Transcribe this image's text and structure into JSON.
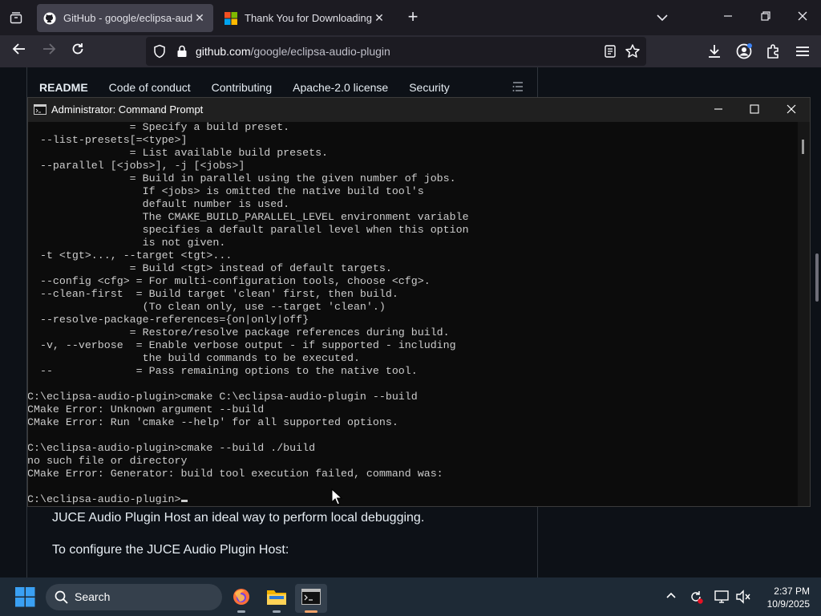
{
  "browser": {
    "tabs": [
      {
        "title": "GitHub - google/eclipsa-audio-plugin",
        "active": true
      },
      {
        "title": "Thank You for Downloading Visual Studio",
        "active": false
      }
    ],
    "url_domain": "github.com",
    "url_path": "/google/eclipsa-audio-plugin"
  },
  "page": {
    "readme_tabs": [
      "README",
      "Code of conduct",
      "Contributing",
      "Apache-2.0 license",
      "Security"
    ],
    "text_line1": "JUCE Audio Plugin Host an ideal way to perform local debugging.",
    "text_line2": "To configure the JUCE Audio Plugin Host:"
  },
  "cmd": {
    "title": "Administrator: Command Prompt",
    "lines": [
      "                = Specify a build preset.",
      "  --list-presets[=<type>]",
      "                = List available build presets.",
      "  --parallel [<jobs>], -j [<jobs>]",
      "                = Build in parallel using the given number of jobs.",
      "                  If <jobs> is omitted the native build tool's",
      "                  default number is used.",
      "                  The CMAKE_BUILD_PARALLEL_LEVEL environment variable",
      "                  specifies a default parallel level when this option",
      "                  is not given.",
      "  -t <tgt>..., --target <tgt>...",
      "                = Build <tgt> instead of default targets.",
      "  --config <cfg> = For multi-configuration tools, choose <cfg>.",
      "  --clean-first  = Build target 'clean' first, then build.",
      "                  (To clean only, use --target 'clean'.)",
      "  --resolve-package-references={on|only|off}",
      "                = Restore/resolve package references during build.",
      "  -v, --verbose  = Enable verbose output - if supported - including",
      "                  the build commands to be executed.",
      "  --             = Pass remaining options to the native tool.",
      "",
      "C:\\eclipsa-audio-plugin>cmake C:\\eclipsa-audio-plugin --build",
      "CMake Error: Unknown argument --build",
      "CMake Error: Run 'cmake --help' for all supported options.",
      "",
      "C:\\eclipsa-audio-plugin>cmake --build ./build",
      "no such file or directory",
      "CMake Error: Generator: build tool execution failed, command was:",
      "",
      "C:\\eclipsa-audio-plugin>"
    ]
  },
  "taskbar": {
    "search_placeholder": "Search",
    "time": "2:37 PM",
    "date": "10/9/2025",
    "apps": [
      "firefox-icon",
      "file-explorer-icon",
      "terminal-icon"
    ]
  },
  "colors": {
    "page_bg": "#0d1117",
    "console_bg": "#0c0c0c",
    "console_text": "#cccccc",
    "taskbar_bg": "#1e2a36"
  }
}
